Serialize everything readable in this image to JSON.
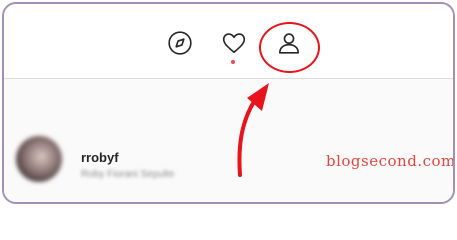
{
  "nav": {
    "icons": [
      "compass-icon",
      "heart-icon",
      "profile-icon"
    ],
    "notification_dot_color": "#ed4956"
  },
  "annotation": {
    "highlight_target": "profile-icon",
    "color": "#e8131b"
  },
  "suggestion": {
    "username": "rrobyf",
    "fullname": "Roby Fiorani Sepulte"
  },
  "watermark": {
    "text": "blogsecond.com"
  },
  "colors": {
    "border": "#a58fb8",
    "background": "#fafafa"
  }
}
